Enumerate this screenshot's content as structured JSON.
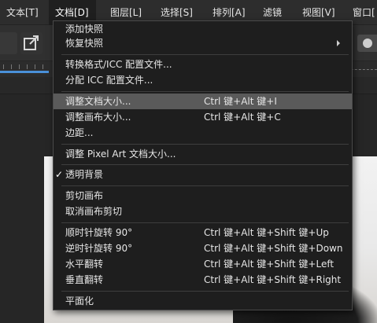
{
  "menubar": {
    "items": [
      {
        "label": "文本[T]"
      },
      {
        "label": "文档[D]"
      },
      {
        "label": "图层[L]"
      },
      {
        "label": "选择[S]"
      },
      {
        "label": "排列[A]"
      },
      {
        "label": "滤镜"
      },
      {
        "label": "视图[V]"
      },
      {
        "label": "窗口["
      }
    ]
  },
  "document_menu": {
    "items": [
      {
        "label": "添加快照"
      },
      {
        "label": "恢复快照",
        "submenu_icon": "chevron-right-icon"
      },
      {
        "label": "转换格式/ICC 配置文件..."
      },
      {
        "label": "分配 ICC 配置文件..."
      },
      {
        "label": "调整文档大小...",
        "shortcut": "Ctrl 键+Alt 键+I",
        "highlighted": true
      },
      {
        "label": "调整画布大小...",
        "shortcut": "Ctrl 键+Alt 键+C"
      },
      {
        "label": "边距..."
      },
      {
        "label": "调整 Pixel Art 文档大小..."
      },
      {
        "label": "透明背景",
        "checked": true,
        "check_icon": "checkmark-icon"
      },
      {
        "label": "剪切画布"
      },
      {
        "label": "取消画布剪切"
      },
      {
        "label": "顺时针旋转 90°",
        "shortcut": "Ctrl 键+Alt 键+Shift 键+Up"
      },
      {
        "label": "逆时针旋转 90°",
        "shortcut": "Ctrl 键+Alt 键+Shift 键+Down"
      },
      {
        "label": "水平翻转",
        "shortcut": "Ctrl 键+Alt 键+Shift 键+Left"
      },
      {
        "label": "垂直翻转",
        "shortcut": "Ctrl 键+Alt 键+Shift 键+Right"
      },
      {
        "label": "平面化"
      }
    ],
    "check_mark": "✓"
  },
  "colors": {
    "menu_bg": "#1e1e1e",
    "highlight": "#5a5a5a",
    "menubar_bg": "#2d2d2d",
    "ruler_accent": "#4a90d9"
  }
}
